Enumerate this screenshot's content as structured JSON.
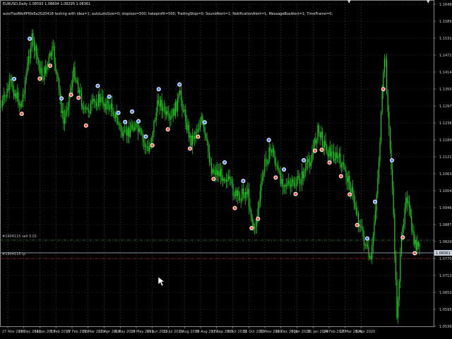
{
  "chart": {
    "symbol_line": "EURUSD,Daily 1.08593 1.08694 1.08295 1.08361",
    "params_line": "autoTradWolfPl0eEa2020418 testing with idea=1; autoLotsSize=0; stoploss=500; takeprofit=500; TrailingStop=0; SoundAlert=1; NotificationAlert=1; MessageBoxAlert=1; TimeFrame=0;",
    "order_labels": {
      "sell": "#1904115 sell 0.01",
      "tp": "#1904115 tp"
    },
    "current_price": "1.08361",
    "price_labels": [
      "1.16480",
      "1.15895",
      "1.15310",
      "1.14725",
      "1.14140",
      "1.13555",
      "1.12970",
      "1.12385",
      "1.11800",
      "1.11215",
      "1.10630",
      "1.10045",
      "1.09460",
      "1.08875",
      "1.08290",
      "1.07705",
      "1.07120",
      "1.06535",
      "1.05950",
      "1.05365"
    ],
    "date_labels": [
      "27 Nov 2018",
      "19 Dec 2018",
      "14 Jan 2019",
      "5 Feb 2019",
      "27 Feb 2019",
      "21 Mar 2019",
      "12 Apr 2019",
      "6 May 2019",
      "28 May 2019",
      "19 Jun 2019",
      "11 Jul 2019",
      "2 Aug 2019",
      "26 Aug 2019",
      "17 Sep 2019",
      "9 Oct 2019",
      "31 Oct 2019",
      "22 Nov 2019",
      "16 Dec 2019",
      "9 Jan 2020",
      "31 Jan 2020",
      "24 Feb 2020",
      "17 Mar 2020",
      "8 Apr 2020"
    ],
    "colors": {
      "background": "#000000",
      "grid": "#5a5a5a",
      "candle": "#1fd21f",
      "sell_line": "#2e8b2e",
      "tp_line": "#c82020",
      "bid_line": "#b0c4de",
      "arrow_up": "#3a7bff",
      "arrow_down": "#ff4a2a"
    }
  },
  "chart_data": {
    "type": "candlestick",
    "series": [
      {
        "x": [
          "27 Nov 2018",
          "19 Dec 2018",
          "14 Jan 2019",
          "5 Feb 2019",
          "27 Feb 2019",
          "21 Mar 2019",
          "12 Apr 2019",
          "6 May 2019",
          "28 May 2019",
          "19 Jun 2019",
          "11 Jul 2019",
          "2 Aug 2019",
          "26 Aug 2019",
          "17 Sep 2019",
          "9 Oct 2019",
          "31 Oct 2019",
          "22 Nov 2019",
          "16 Dec 2019",
          "9 Jan 2020",
          "31 Jan 2020",
          "24 Feb 2020",
          "17 Mar 2020",
          "8 Apr 2020"
        ],
        "values": [
          1.139,
          1.142,
          1.146,
          1.133,
          1.133,
          1.129,
          1.129,
          1.12,
          1.125,
          1.134,
          1.126,
          1.11,
          1.108,
          1.099,
          1.108,
          1.112,
          1.1,
          1.11,
          1.114,
          1.104,
          1.119,
          1.07,
          1.087
        ]
      }
    ],
    "ylim": [
      1.05365,
      1.1648
    ]
  }
}
